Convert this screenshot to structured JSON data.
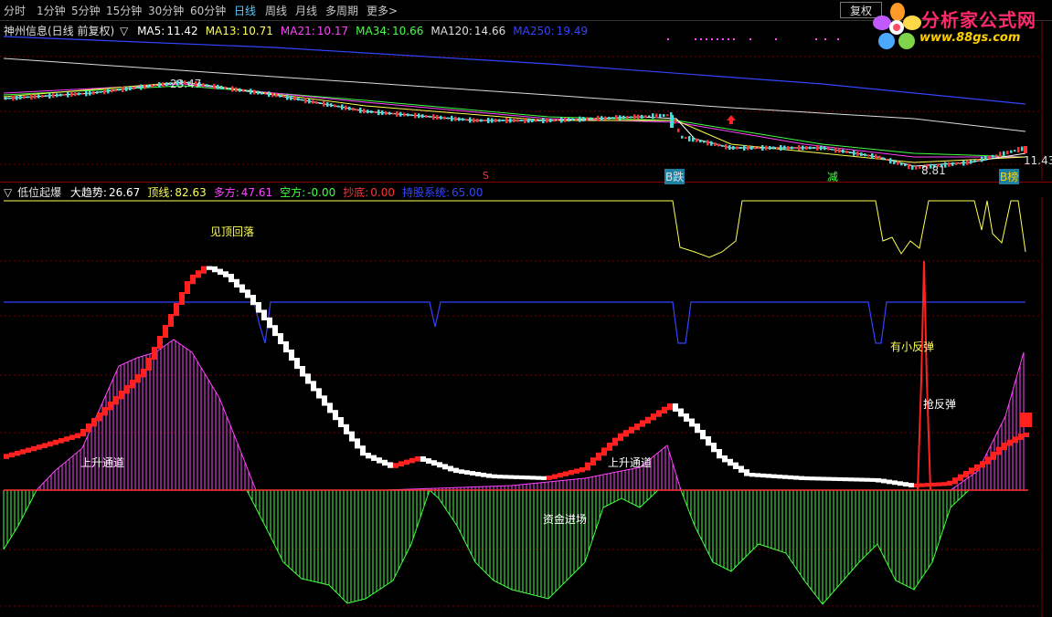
{
  "toolbar": {
    "periods": [
      "分时",
      "1分钟",
      "5分钟",
      "15分钟",
      "30分钟",
      "60分钟",
      "日线",
      "周线",
      "月线",
      "多周期",
      "更多"
    ],
    "active": "日线",
    "more_chevron": ">",
    "fuquan_button": "复权"
  },
  "logo": {
    "title": "分析家公式网",
    "url": "www.88gs.com"
  },
  "upper_header": {
    "stock": "神州信息(日线 前复权)",
    "arrow": "▽",
    "items": [
      {
        "label": "MA5:",
        "value": "11.42",
        "color": "#ffffff"
      },
      {
        "label": "MA13:",
        "value": "10.71",
        "color": "#ffff55"
      },
      {
        "label": "MA21:",
        "value": "10.17",
        "color": "#ff44ff"
      },
      {
        "label": "MA34:",
        "value": "10.66",
        "color": "#44ff44"
      },
      {
        "label": "MA120:",
        "value": "14.66",
        "color": "#dddddd"
      },
      {
        "label": "MA250:",
        "value": "19.49",
        "color": "#3344ff"
      }
    ]
  },
  "upper_annotations": {
    "high_price": "23.47",
    "low_price": "8.81",
    "last_price": "11.43",
    "s_marker": "S",
    "b_die": "B跌",
    "jian": "减",
    "b_bang": "B榜"
  },
  "lower_header": {
    "arrow": "▽",
    "indicator": "低位起爆",
    "items": [
      {
        "label": "大趋势:",
        "value": "26.67",
        "color": "#ffffff"
      },
      {
        "label": "顶线:",
        "value": "82.63",
        "color": "#ffff55"
      },
      {
        "label": "多方:",
        "value": "47.61",
        "color": "#ff44ff"
      },
      {
        "label": "空方:",
        "value": "-0.00",
        "color": "#44ff44"
      },
      {
        "label": "抄底:",
        "value": "0.00",
        "color": "#ff3333"
      },
      {
        "label": "持股系统:",
        "value": "65.00",
        "color": "#3344ff"
      }
    ]
  },
  "lower_annotations": {
    "jian_ding": "见顶回落",
    "shangsheng1": "上升通道",
    "shangsheng2": "上升通道",
    "zijin": "资金进场",
    "you_xiao": "有小反弹",
    "qiang": "抢反弹"
  },
  "colors": {
    "ma5": "#ffffff",
    "ma13": "#ffff55",
    "ma21": "#ff44ff",
    "ma34": "#44ff44",
    "ma120": "#dddddd",
    "ma250": "#3344ff",
    "up": "#ff3333",
    "down": "#40e0e0",
    "grid": "#7a0000",
    "active_tab": "#58c8ff",
    "duofang": "#ff44ff",
    "kongfang": "#44ff44"
  }
}
